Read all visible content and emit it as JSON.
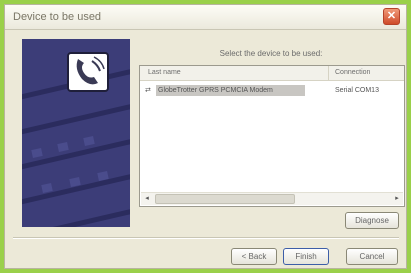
{
  "window": {
    "title": "Device to be used",
    "close_glyph": "✕"
  },
  "main": {
    "instruction": "Select the device to be used:",
    "list": {
      "columns": [
        "Last name",
        "Connection"
      ],
      "rows": [
        {
          "icon": "modem-icon",
          "icon_glyph": "⇄",
          "name": "GlobeTrotter GPRS PCMCIA Modem",
          "connection": "Serial COM13"
        }
      ]
    },
    "scroll_left_glyph": "◂",
    "scroll_right_glyph": "▸",
    "diagnose_label": "Diagnose"
  },
  "footer": {
    "back_label": "< Back",
    "finish_label": "Finish",
    "cancel_label": "Cancel"
  },
  "colors": {
    "background": "#9ad04a",
    "sidebar": "#3c3d78",
    "dialog": "#ece9d8",
    "close": "#cf4b2a"
  }
}
